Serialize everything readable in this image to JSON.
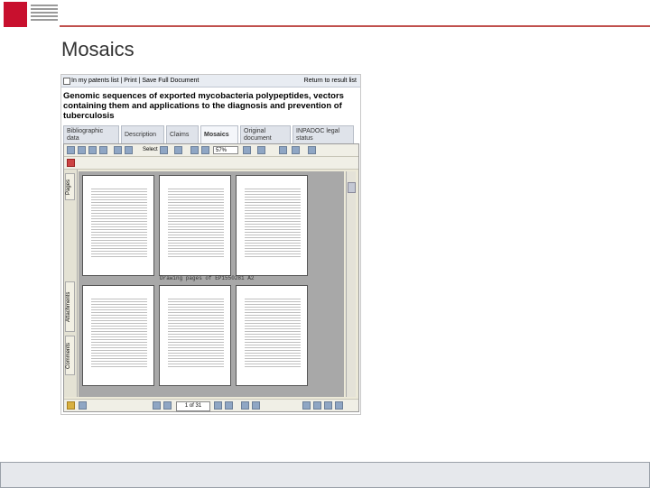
{
  "slide": {
    "title": "Mosaics"
  },
  "window": {
    "topbar": {
      "checkbox_label": "In my patents list",
      "links": "In my patents list  |  Print  |  Save Full Document",
      "return_link": "Return to result list"
    },
    "document_title": "Genomic sequences of exported mycobacteria polypeptides, vectors containing them and applications to the diagnosis and prevention of tuberculosis",
    "tabs": [
      {
        "label": "Bibliographic data"
      },
      {
        "label": "Description"
      },
      {
        "label": "Claims"
      },
      {
        "label": "Mosaics"
      },
      {
        "label": "Original document"
      },
      {
        "label": "INPADOC legal status"
      }
    ],
    "viewer": {
      "select_label": "Select",
      "zoom": "57%",
      "side_tabs": [
        "Pages",
        "Attachments",
        "Comments"
      ],
      "caption": "Drawing pages of EP1550281 A2",
      "page_indicator": "1 of 31"
    }
  }
}
